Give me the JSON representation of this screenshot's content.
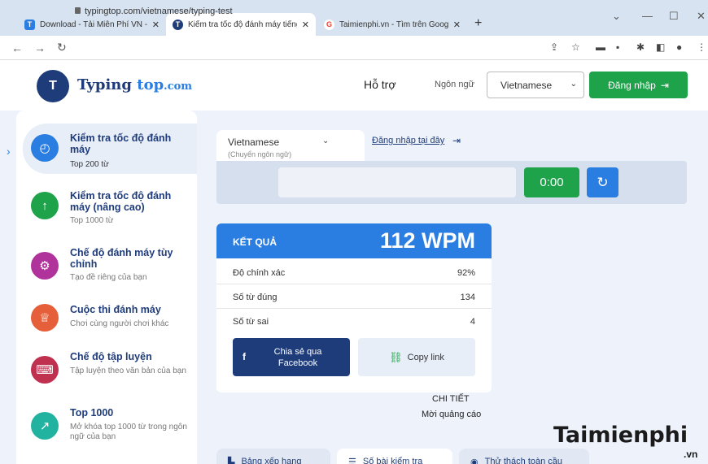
{
  "browser": {
    "tabs": [
      {
        "title": "Download - Tải Miễn Phí VN - Pl",
        "icon": "taimienphi-favicon",
        "color": "#2a7de1",
        "glyph": "T"
      },
      {
        "title": "Kiểm tra tốc độ đánh máy tiếng V",
        "icon": "typingtop-favicon",
        "color": "#1f3c7a",
        "glyph": "T"
      },
      {
        "title": "Taimienphi.vn - Tìm trên Google",
        "icon": "google-favicon",
        "color": "#ea4335",
        "glyph": "G"
      }
    ],
    "url": "typingtop.com/vietnamese/typing-test"
  },
  "header": {
    "logo_mark": "T",
    "logo_name": "Typing",
    "logo_top": "top",
    "logo_tld": ".com",
    "help": "Hỗ trợ",
    "language_label": "Ngôn ngữ",
    "language_value": "Vietnamese",
    "login": "Đăng nhập"
  },
  "sidebar": {
    "items": [
      {
        "title": "Kiểm tra tốc độ đánh máy",
        "sub": "Top 200 từ",
        "icon": "clock-icon",
        "color": "#2a7de1"
      },
      {
        "title": "Kiểm tra tốc độ đánh máy (nâng cao)",
        "sub": "Top 1000 từ",
        "icon": "arrow-up-icon",
        "color": "#1ea34b"
      },
      {
        "title": "Chế độ đánh máy tùy chỉnh",
        "sub": "Tạo đề riêng của bạn",
        "icon": "gear-icon",
        "color": "#b0339b"
      },
      {
        "title": "Cuộc thi đánh máy",
        "sub": "Chơi cùng người chơi khác",
        "icon": "trophy-icon",
        "color": "#e5603a"
      },
      {
        "title": "Chế độ tập luyện",
        "sub": "Tập luyện theo văn bản của bạn",
        "icon": "keyboard-icon",
        "color": "#c0304f"
      },
      {
        "title": "Top 1000",
        "sub": "Mở khóa top 1000 từ trong ngôn ngữ của bạn",
        "icon": "chart-icon",
        "color": "#22b3a0"
      }
    ]
  },
  "test": {
    "language": "Vietnamese",
    "language_sub": "(Chuyển ngôn ngữ)",
    "login_here": "Đăng nhập tại đây",
    "timer": "0:00"
  },
  "result": {
    "heading": "KẾT QUẢ",
    "wpm": "112 WPM",
    "rows": [
      {
        "label": "Độ chính xác",
        "value": "92%"
      },
      {
        "label": "Số từ đúng",
        "value": "134"
      },
      {
        "label": "Số từ sai",
        "value": "4"
      }
    ],
    "share_facebook": "Chia sẻ qua Facebook",
    "copy_link": "Copy link",
    "detail": "CHI TIẾT",
    "ads": "Mời quảng cáo"
  },
  "bottom_tabs": [
    {
      "label": "Bảng xếp hạng",
      "icon": "ranking-icon"
    },
    {
      "label": "Số bài kiểm tra",
      "icon": "list-icon"
    },
    {
      "label": "Thử thách toàn cầu",
      "icon": "globe-icon"
    }
  ],
  "watermark": {
    "main": "Taimienphi",
    "suffix": ".vn"
  }
}
